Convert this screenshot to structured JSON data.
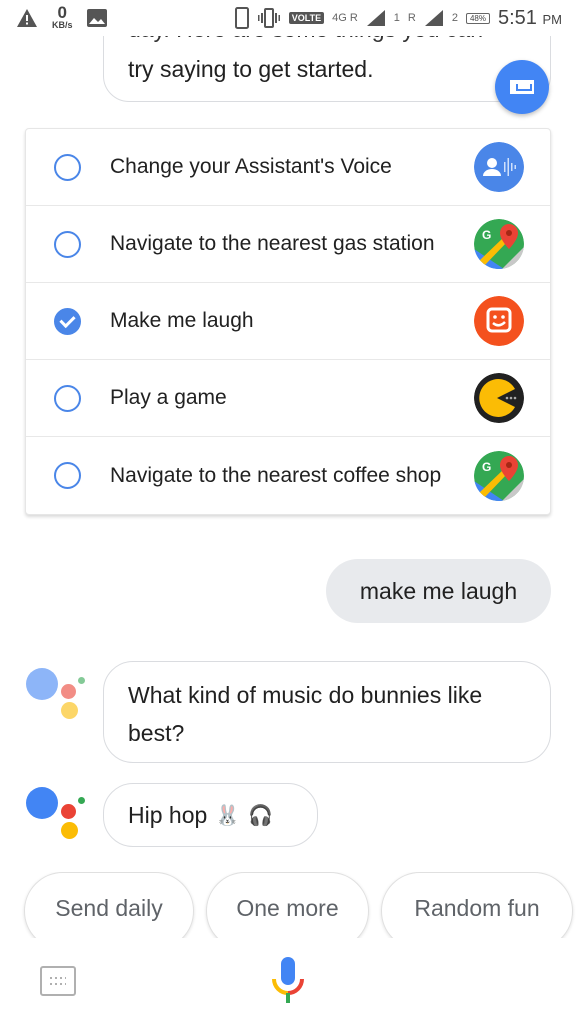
{
  "status_bar": {
    "network_speed_value": "0",
    "network_speed_unit": "KB/s",
    "volte_label": "VOLTE",
    "network_type": "4G R",
    "sim1_label": "1",
    "sim2_roaming": "R",
    "sim2_label": "2",
    "battery": "48%",
    "time": "5:51",
    "ampm": "PM",
    "icons": [
      "warning-icon",
      "image-icon",
      "phone-outline-icon",
      "vibrate-icon",
      "signal-icon",
      "battery-icon"
    ]
  },
  "intro_bubble": {
    "line1_partial": "day. Here are some things you can",
    "line2": "try saying to get started."
  },
  "fab": {
    "icon": "keyboard-collapse-icon",
    "color": "#4285f4"
  },
  "suggestions": [
    {
      "label": "Change your Assistant's Voice",
      "checked": false,
      "icon": "assistant-voice-icon"
    },
    {
      "label": "Navigate to the nearest gas station",
      "checked": false,
      "icon": "google-maps-icon"
    },
    {
      "label": "Make me laugh",
      "checked": true,
      "icon": "sticker-smiley-icon"
    },
    {
      "label": "Play a game",
      "checked": false,
      "icon": "pacman-game-icon"
    },
    {
      "label": "Navigate to the nearest coffee shop",
      "checked": false,
      "icon": "google-maps-icon"
    }
  ],
  "conversation": {
    "user_message": "make me laugh",
    "assistant_question": "What kind of music do bunnies like best?",
    "assistant_answer": "Hip hop",
    "answer_emojis": [
      "🐰",
      "🎧"
    ]
  },
  "chips": [
    "Send daily",
    "One more",
    "Random fun"
  ],
  "bottom_bar": {
    "left_icon": "keyboard-icon",
    "center_icon": "microphone-icon"
  },
  "colors": {
    "accent_blue": "#4285f4",
    "red": "#ea4335",
    "yellow": "#fbbc05",
    "green": "#34a853",
    "user_bubble": "#e8eaed"
  }
}
